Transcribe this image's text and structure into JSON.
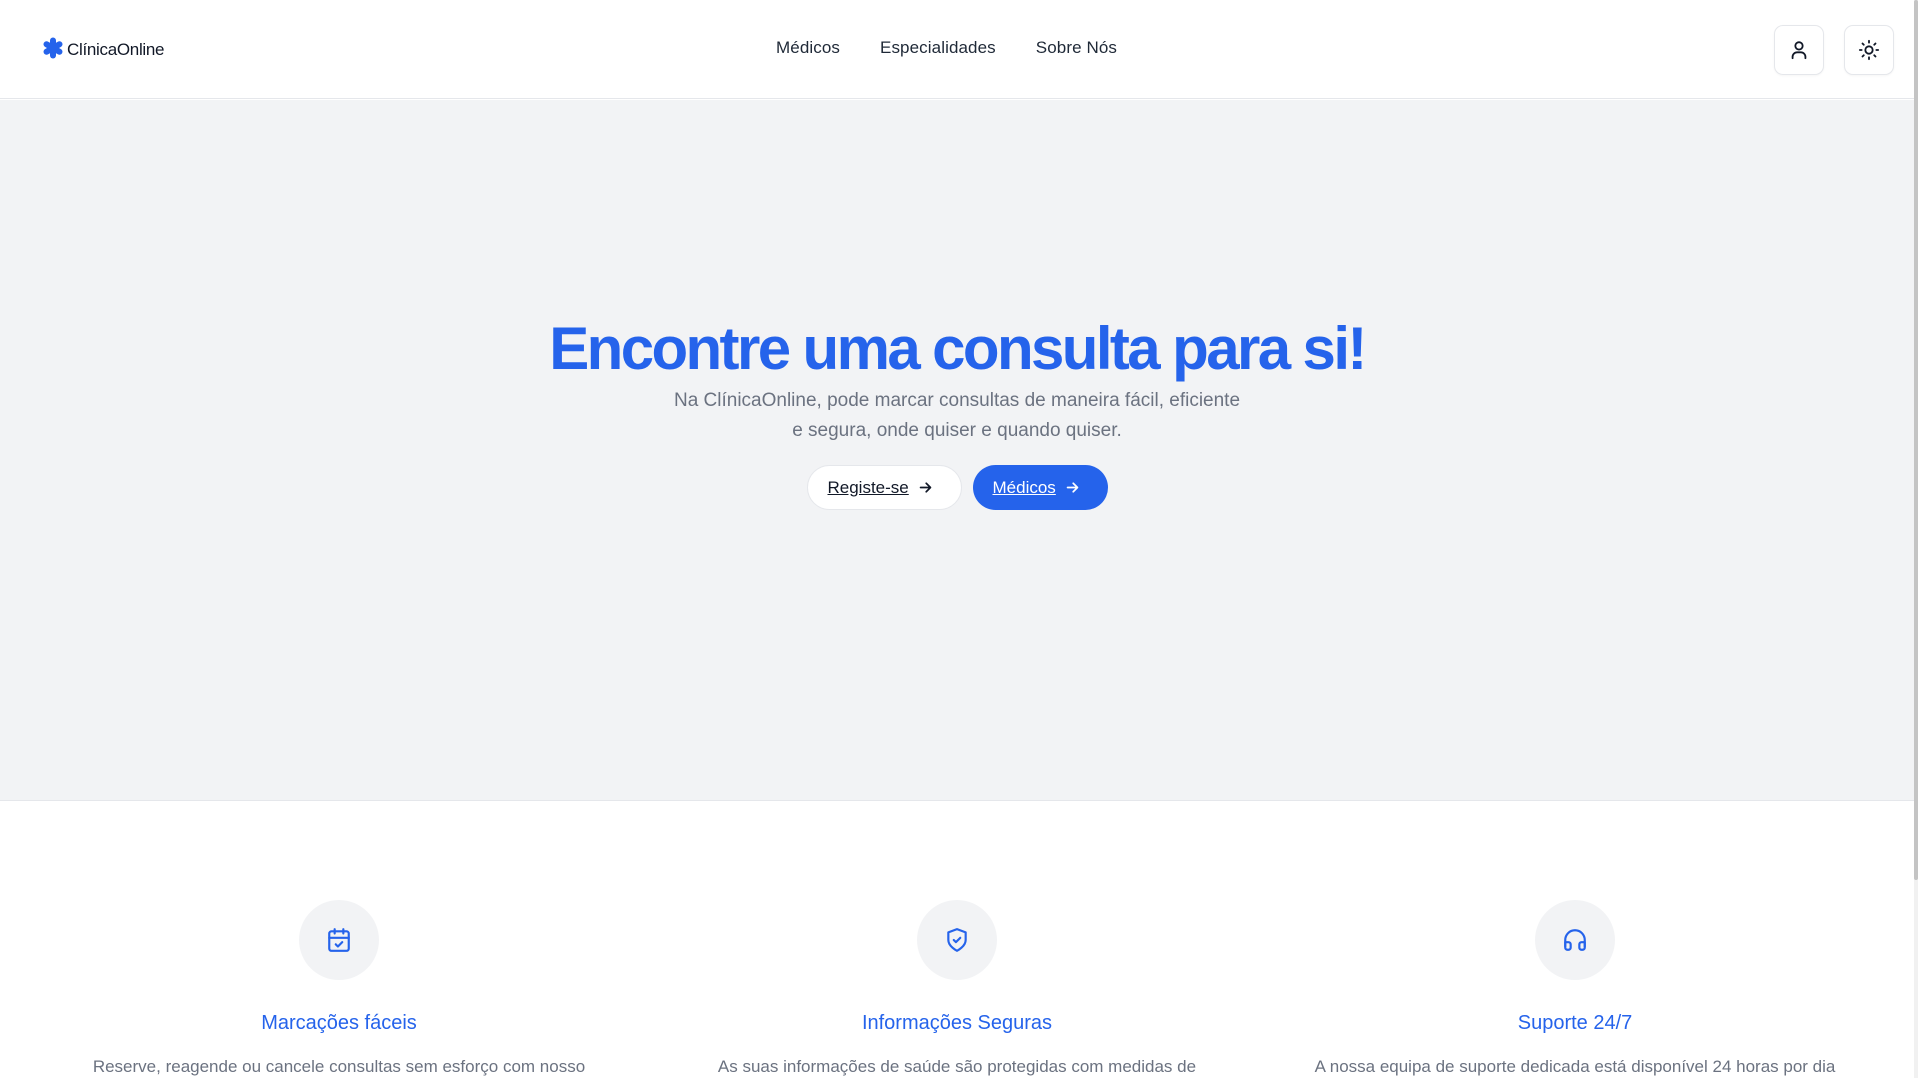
{
  "header": {
    "logo_text": "ClínicaOnline",
    "nav": [
      "Médicos",
      "Especialidades",
      "Sobre Nós"
    ],
    "user_icon": "user-icon",
    "theme_icon": "sun-icon"
  },
  "hero": {
    "title": "Encontre uma consulta para si!",
    "subtitle_line1": "Na ClínicaOnline, pode marcar consultas de maneira fácil, eficiente",
    "subtitle_line2": "e segura, onde quiser e quando quiser.",
    "register_label": "Registe-se",
    "doctors_label": "Médicos"
  },
  "features": [
    {
      "icon": "calendar-check-icon",
      "title": "Marcações fáceis",
      "desc": "Reserve, reagende ou cancele consultas sem esforço com nosso"
    },
    {
      "icon": "shield-check-icon",
      "title": "Informações Seguras",
      "desc": "As suas informações de saúde são protegidas com medidas de"
    },
    {
      "icon": "headphones-icon",
      "title": "Suporte 24/7",
      "desc": "A nossa equipa de suporte dedicada está disponível 24 horas por dia"
    }
  ],
  "colors": {
    "accent": "#2563eb",
    "hero_bg": "#f2f3f5",
    "muted_text": "#6b7280"
  }
}
